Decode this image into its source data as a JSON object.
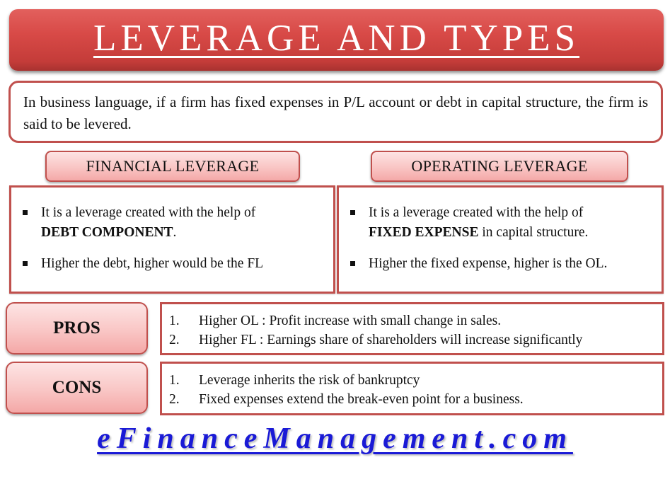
{
  "title": "LEVERAGE AND TYPES",
  "intro": "In business language, if a firm has fixed expenses in P/L account or debt in capital structure, the firm is said to be levered.",
  "financial_leverage": {
    "header": "FINANCIAL LEVERAGE",
    "bullets": [
      {
        "text_before": "It is a leverage created with the help of ",
        "bold": "DEBT COMPONENT",
        "text_after": "."
      },
      {
        "text": "Higher the debt, higher would be the FL"
      }
    ]
  },
  "operating_leverage": {
    "header": "OPERATING LEVERAGE",
    "bullets": [
      {
        "text_before": "It is a leverage created with the help of ",
        "bold": "FIXED EXPENSE",
        "text_after": " in capital structure."
      },
      {
        "text": "Higher the fixed expense, higher is the OL."
      }
    ]
  },
  "pros": {
    "label": "PROS",
    "items": [
      {
        "num": "1.",
        "text": "Higher OL : Profit increase with small change in sales."
      },
      {
        "num": "2.",
        "text": "Higher FL : Earnings share of shareholders will increase significantly"
      }
    ]
  },
  "cons": {
    "label": "CONS",
    "items": [
      {
        "num": "1.",
        "text": "Leverage inherits the risk of bankruptcy"
      },
      {
        "num": "2.",
        "text": "Fixed expenses extend the break-even point for a business."
      }
    ]
  },
  "footer": "eFinanceManagement.com",
  "colors": {
    "accent_red": "#c0504d",
    "banner_red": "#d84a47",
    "pink_fill": "#f9c5c4",
    "link_blue": "#1a1ad6"
  }
}
